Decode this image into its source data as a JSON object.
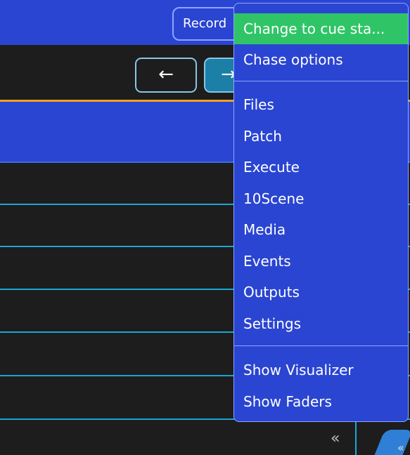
{
  "toolbar": {
    "record_label": "Record",
    "back_arrow": "←",
    "forward_arrow": "→"
  },
  "footer": {
    "collapse_glyph": "«",
    "corner_glyph": "«"
  },
  "menu": {
    "items": [
      {
        "label": "Change to cue sta...",
        "active": true
      },
      {
        "label": "Chase options"
      },
      {
        "label": "Files"
      },
      {
        "label": "Patch"
      },
      {
        "label": "Execute"
      },
      {
        "label": "10Scene"
      },
      {
        "label": "Media"
      },
      {
        "label": "Events"
      },
      {
        "label": "Outputs"
      },
      {
        "label": "Settings"
      },
      {
        "label": "Show Visualizer"
      },
      {
        "label": "Show Faders"
      }
    ]
  },
  "colors": {
    "panel_blue": "#2a45d1",
    "active_green": "#2fc566",
    "accent_orange": "#f0a126",
    "divider_cyan": "#1aa7d4"
  }
}
